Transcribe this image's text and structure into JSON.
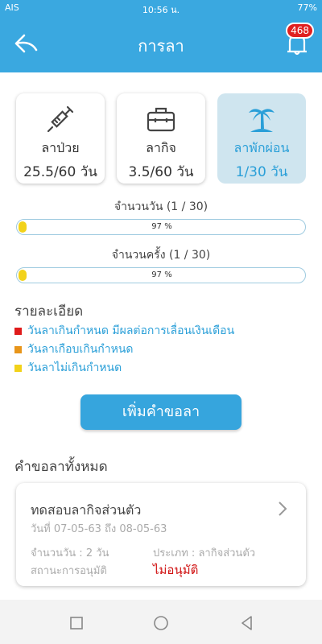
{
  "status": {
    "carrier": "AIS",
    "time": "10:56 น.",
    "battery": "77%"
  },
  "header": {
    "title": "การลา",
    "notification_count": "468"
  },
  "leave_types": [
    {
      "label": "ลาป่วย",
      "value": "25.5/60 วัน",
      "icon": "syringe-icon"
    },
    {
      "label": "ลากิจ",
      "value": "3.5/60 วัน",
      "icon": "briefcase-icon"
    },
    {
      "label": "ลาพักผ่อน",
      "value": "1/30 วัน",
      "icon": "palm-tree-icon"
    }
  ],
  "progress": {
    "days_title": "จำนวนวัน (1 / 30)",
    "days_text": "97 %",
    "times_title": "จำนวนครั้ง (1 / 30)",
    "times_text": "97 %"
  },
  "details": {
    "heading": "รายละเอียด",
    "items": [
      {
        "text": "วันลาเกินกำหนด มีผลต่อการเลื่อนเงินเดือน",
        "color": "#e01b1b"
      },
      {
        "text": "วันลาเกือบเกินกำหนด",
        "color": "#e8951a"
      },
      {
        "text": "วันลาไม่เกินกำหนด",
        "color": "#f2d21a"
      }
    ]
  },
  "add_button": "เพิ่มคำขอลา",
  "requests": {
    "heading": "คำขอลาทั้งหมด",
    "items": [
      {
        "title": "ทดสอบลากิจส่วนตัว",
        "dates": "วันที่ 07-05-63 ถึง 08-05-63",
        "days": "จำนวนวัน : 2 วัน",
        "type": "ประเภท : ลากิจส่วนตัว",
        "status_label": "สถานะการอนุมัติ",
        "status_value": "ไม่อนุมัติ",
        "status_color": "#d01010"
      }
    ]
  },
  "colors": {
    "primary": "#3aa8e0",
    "accent_bg": "#cfe5ef"
  }
}
